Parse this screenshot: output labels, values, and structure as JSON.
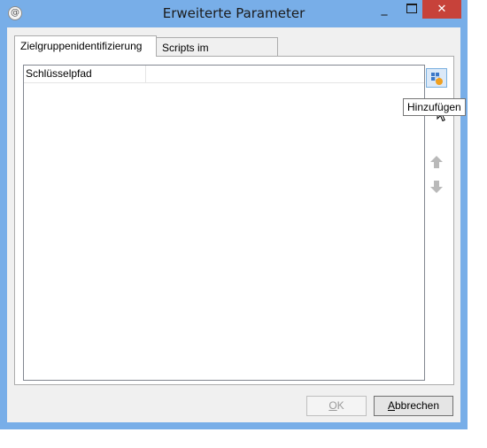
{
  "window": {
    "title": "Erweiterte Parameter",
    "minimize_glyph": "_",
    "close_glyph": "✕",
    "accent_color": "#78aee8",
    "close_color": "#c7423a"
  },
  "tabs": [
    {
      "label": "Zielgruppenidentifizierung",
      "selected": true
    },
    {
      "label": "Scripts im Einzelmodus",
      "selected": false
    }
  ],
  "list": {
    "columns": [
      "Schlüsselpfad",
      ""
    ],
    "rows": []
  },
  "side_buttons": {
    "add_icon": "add-item-icon",
    "up_icon": "arrow-up-icon",
    "down_icon": "arrow-down-icon"
  },
  "tooltip": {
    "text": "Hinzufügen"
  },
  "buttons": {
    "ok": {
      "mnemonic": "O",
      "rest": "K",
      "enabled": false
    },
    "cancel": {
      "mnemonic": "A",
      "rest": "bbrechen",
      "enabled": true
    }
  }
}
